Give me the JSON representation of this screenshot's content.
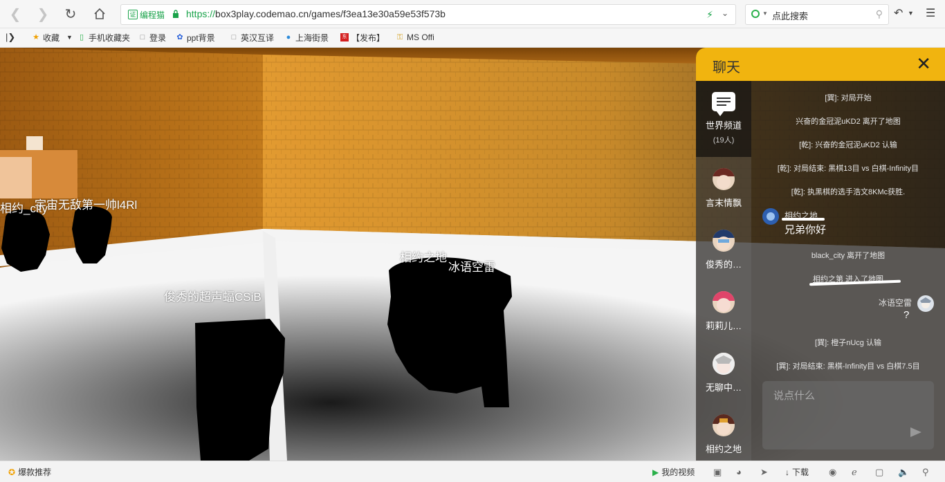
{
  "browser": {
    "site_tag": "编程猫",
    "url_protocol": "https://",
    "url_rest": "box3play.codemao.cn/games/f3ea13e30a59e53f573b",
    "search_placeholder": "点此搜索",
    "bookmarks": [
      "收藏",
      "手机收藏夹",
      "登录",
      "ppt背景",
      "英汉互译",
      "上海街景",
      "【发布】",
      "MS Offi"
    ]
  },
  "game": {
    "labels": [
      "相约_city",
      "宇宙无敌第一帅l4Rl",
      "俊秀的超声蝠CSiB",
      "相约之地",
      "冰语空雷"
    ]
  },
  "chat": {
    "title": "聊天",
    "world_channel": {
      "label": "世界频道",
      "count": "(19人)"
    },
    "members": [
      "言末情飘",
      "俊秀的…",
      "莉莉儿…",
      "无聊中…",
      "相约之地"
    ],
    "messages": {
      "sys1": "[巽]: 对局开始",
      "sys2": "兴奋的金冠泥uKD2 离开了地图",
      "sys3": "[乾]: 兴奋的金冠泥uKD2 认输",
      "sys4": "[乾]: 对局结束: 黑棋13目 vs 白棋-Infinity目",
      "sys5": "[乾]: 执黑棋的选手浩文8KMc获胜.",
      "user1_name": "相约之地",
      "user1_text": "兄弟你好",
      "sys6": "black_city 离开了地图",
      "sys7": "相约之第 进入了地图",
      "user2_name": "冰语空雷",
      "user2_text": "?",
      "sys8": "[巽]: 橙子nUcg 认输",
      "sys9": "[巽]: 对局结束: 黑棋-Infinity目 vs 白棋7.5目"
    },
    "input_placeholder": "说点什么"
  },
  "statusbar": {
    "left": "爆款推荐",
    "video": "我的视频",
    "download": "下载"
  },
  "colors": {
    "accent": "#f1b40f",
    "url_green": "#1aa34a"
  }
}
